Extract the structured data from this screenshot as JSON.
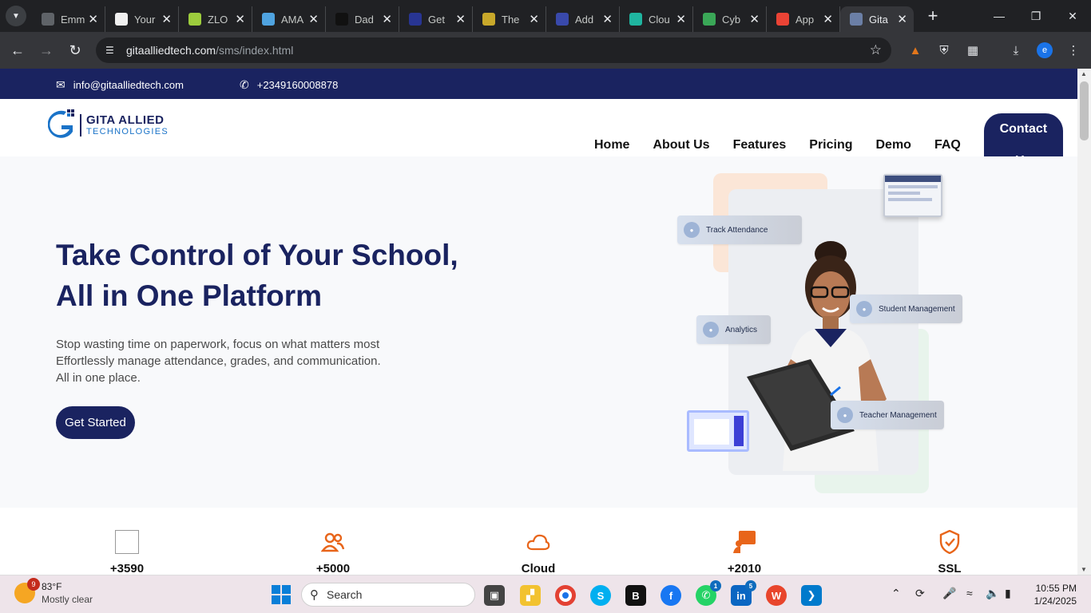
{
  "browser": {
    "tabs": [
      {
        "title": "Emm",
        "color": "#5f6368"
      },
      {
        "title": "Your",
        "color": "#f0f0f0"
      },
      {
        "title": "ZLO",
        "color": "#9ccc3d"
      },
      {
        "title": "AMA",
        "color": "#4fa3e0"
      },
      {
        "title": "Dad",
        "color": "#111111"
      },
      {
        "title": "Get",
        "color": "#283593"
      },
      {
        "title": "The",
        "color": "#c8a82a"
      },
      {
        "title": "Add",
        "color": "#3949ab"
      },
      {
        "title": "Clou",
        "color": "#1fb5a0"
      },
      {
        "title": "Cyb",
        "color": "#3aa757"
      },
      {
        "title": "App",
        "color": "#ea4335"
      },
      {
        "title": "Gita",
        "color": "#6b7fa6"
      }
    ],
    "url_host": "gitaalliedtech.com",
    "url_path": "/sms/index.html",
    "profile_initial": "e"
  },
  "site": {
    "email": "info@gitaalliedtech.com",
    "phone": "+2349160008878",
    "logo_line1": "GITA ALLIED",
    "logo_line2": "TECHNOLOGIES",
    "nav": [
      "Home",
      "About Us",
      "Features",
      "Pricing",
      "Demo",
      "FAQ"
    ],
    "nav_cta": "Contact Us",
    "hero": {
      "title_line1": "Take Control of Your School,",
      "title_line2": "All in One Platform",
      "sub_line1": "Stop wasting time on paperwork, focus on what matters most",
      "sub_line2": "Effortlessly manage attendance, grades, and communication.",
      "sub_line3": "All in one place.",
      "button": "Get Started",
      "pills": {
        "track": "Track Attendance",
        "analytics": "Analytics",
        "student": "Student Management",
        "teacher": "Teacher Management"
      }
    },
    "stats": [
      {
        "value": "+3590",
        "icon": "broken-image-icon"
      },
      {
        "value": "+5000",
        "icon": "users-icon"
      },
      {
        "value": "Cloud",
        "icon": "cloud-icon"
      },
      {
        "value": "+2010",
        "icon": "presenter-icon"
      },
      {
        "value": "SSL",
        "icon": "shield-check-icon"
      }
    ],
    "accent_navy": "#1a2360",
    "accent_orange": "#e8651a"
  },
  "taskbar": {
    "temperature": "83°F",
    "weather": "Mostly clear",
    "weather_badge": "9",
    "search_placeholder": "Search",
    "whatsapp_badge": "1",
    "linkedin_badge": "5",
    "time": "10:55 PM",
    "date": "1/24/2025"
  }
}
